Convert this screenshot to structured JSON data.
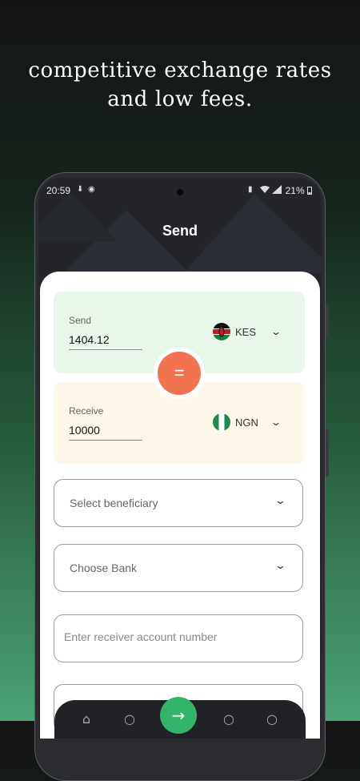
{
  "headline": {
    "line1": "competitive exchange rates",
    "line2": "and low fees."
  },
  "status_bar": {
    "time": "20:59",
    "icons": [
      "download-icon",
      "notification-icon",
      "wifi-icon",
      "signal-icon",
      "battery-icon"
    ],
    "battery": "21%"
  },
  "app": {
    "title": "Send",
    "send": {
      "label": "Send",
      "amount": "1404.12",
      "currency": "KES",
      "flag_icon": "kenya-flag-icon"
    },
    "receive": {
      "label": "Receive",
      "amount": "10000",
      "currency": "NGN",
      "flag_icon": "nigeria-flag-icon"
    },
    "equals_label": "=",
    "beneficiary": {
      "placeholder": "Select beneficiary"
    },
    "bank": {
      "placeholder": "Choose Bank"
    },
    "account": {
      "placeholder": "Enter receiver account number"
    }
  },
  "colors": {
    "accent_orange": "#f17350",
    "send_panel": "#e9f7ea",
    "receive_panel": "#fdf8e9",
    "nav_fab": "#34b36a",
    "background_top": "#151515",
    "background_bottom": "#4aa476"
  }
}
